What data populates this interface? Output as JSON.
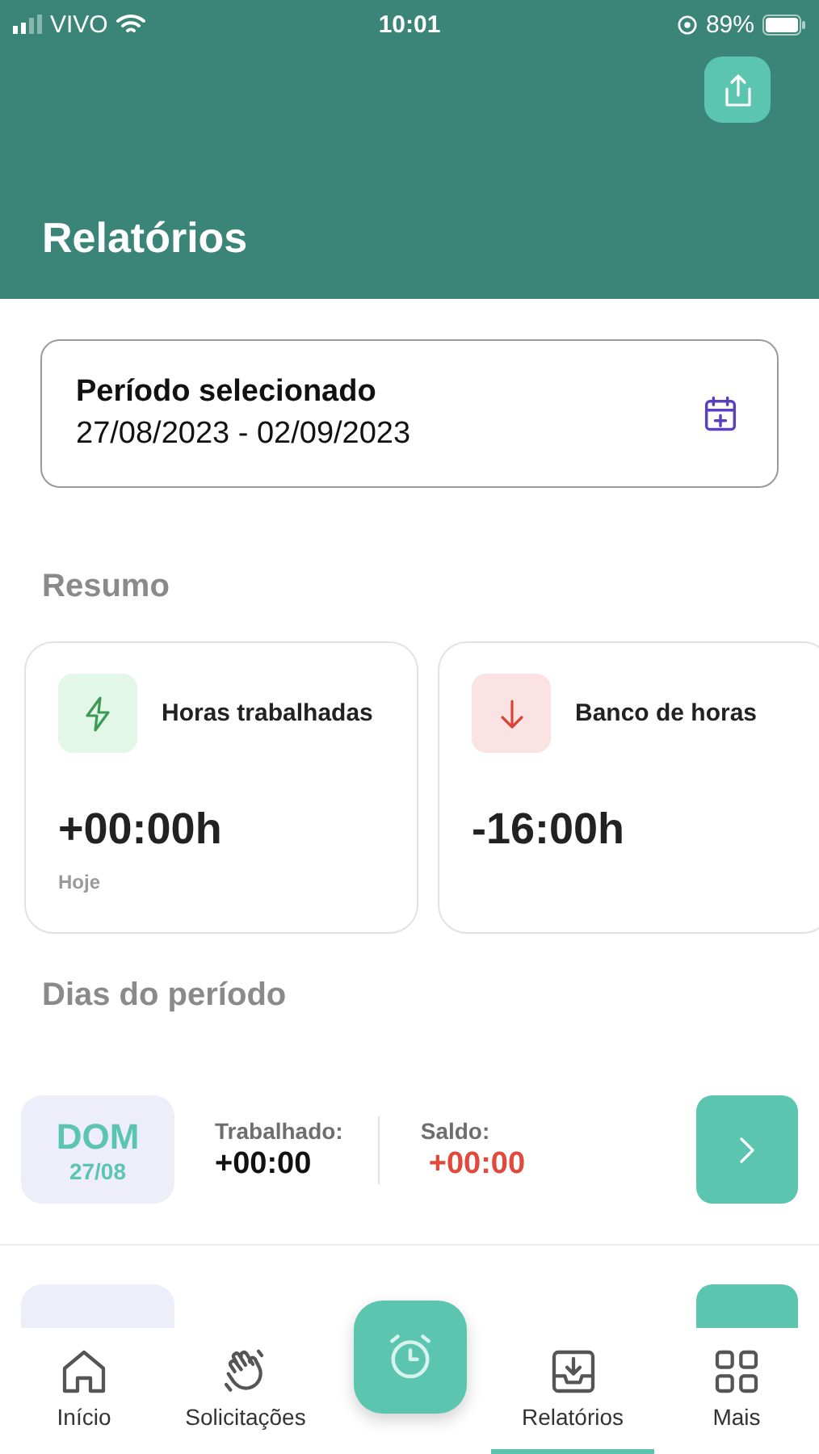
{
  "status_bar": {
    "carrier": "VIVO",
    "time": "10:01",
    "battery": "89%"
  },
  "header": {
    "title": "Relatórios"
  },
  "period": {
    "label": "Período selecionado",
    "range": "27/08/2023 - 02/09/2023"
  },
  "summary": {
    "title": "Resumo",
    "cards": [
      {
        "kind": "up",
        "label": "Horas trabalhadas",
        "value": "+00:00h",
        "note": "Hoje"
      },
      {
        "kind": "down",
        "label": "Banco de horas",
        "value": "-16:00h"
      }
    ]
  },
  "days": {
    "title": "Dias do período",
    "rows": [
      {
        "kind": "full",
        "day": "DOM",
        "date": "27/08",
        "worked_label": "Trabalhado:",
        "worked": "+00:00",
        "balance_label": "Saldo:",
        "balance": "+00:00"
      },
      {
        "kind": "cut"
      }
    ]
  },
  "tab_bar": {
    "tabs": [
      {
        "kind": "home",
        "label": "Início",
        "selected": false
      },
      {
        "kind": "wave",
        "label": "Solicitações",
        "selected": false
      },
      {
        "kind": "reports",
        "label": "Relatórios",
        "selected": true
      },
      {
        "kind": "more",
        "label": "Mais",
        "selected": false
      }
    ]
  }
}
